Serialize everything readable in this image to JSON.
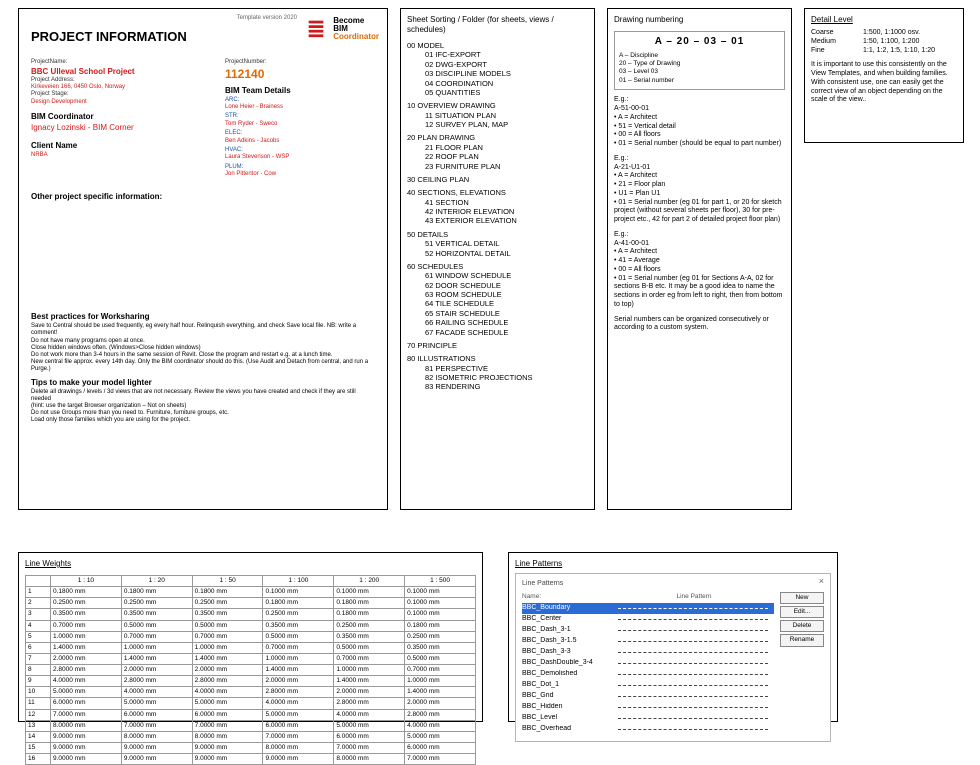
{
  "projectInfo": {
    "templateVersion": "Template version 2020",
    "heading": "PROJECT INFORMATION",
    "logo": {
      "line1": "Become",
      "line2": "BIM",
      "line3": "Coordinator"
    },
    "fields": {
      "projectName_lbl": "ProjectName:",
      "projectName": "BBC Ulleval School Project",
      "projectAddress_lbl": "Project Address:",
      "projectAddress": "Kirkeveien 166, 0450 Oslo, Norway",
      "projectStage_lbl": "Project Stage:",
      "projectStage": "Design Development",
      "projectNumber_lbl": "ProjectNumber:",
      "projectNumber": "112140",
      "bimCoord_h": "BIM Coordinator",
      "bimCoord": "Ignacy Lozinski - BIM Corner",
      "client_h": "Client Name",
      "client": "NRBA",
      "team_h": "BIM Team Details",
      "arc_l": "ARC:",
      "arc": "Lone Heier - Brainess",
      "str_l": "STR:",
      "str": "Tom Ryder - Sweco",
      "elec_l": "ELEC:",
      "elec": "Ben Adkins - Jacobs",
      "hvac_l": "HVAC:",
      "hvac": "Laura Stevenson - WSP",
      "plum_l": "PLUM:",
      "plum": "Jon Pittentor - Cow"
    },
    "otherInfo_h": "Other project specific information:",
    "ws_h": "Best practices for Worksharing",
    "ws_lines": [
      "Save to Central should be used frequently, eg every half hour. Relinquish everything, and check Save local file. NB: write a comment!",
      "Do not have many programs open at once.",
      "Close hidden windows often. (Windows>Close hidden windows)",
      "Do not work more than 3-4 hours in the same session of Revit. Close the program and restart e.g. at a lunch time.",
      "New central file approx. every 14th day. Only the BIM coordinator should do this. (Use Audit and Detach from central, and run a Purge.)"
    ],
    "tips_h": "Tips to make your model lighter",
    "tips_lines": [
      "Delete all drawings / levels / 3d views that are not necessary. Review the views you have created and check if they are still needed",
      "(hint: use the target Browser organization – Not on sheets)",
      "Do not use Groups more than you need to. Furniture, furniture groups, etc.",
      "Load only those families which you are using for the project."
    ]
  },
  "sheetSorting": {
    "heading": "Sheet Sorting / Folder (for sheets, views / schedules)",
    "groups": [
      {
        "h": "00 MODEL",
        "items": [
          "01 IFC-EXPORT",
          "02 DWG-EXPORT",
          "03 DISCIPLINE MODELS",
          "04 COORDINATION",
          "05 QUANTITIES"
        ]
      },
      {
        "h": "10 OVERVIEW DRAWING",
        "items": [
          "11 SITUATION PLAN",
          "12 SURVEY PLAN, MAP"
        ]
      },
      {
        "h": "20 PLAN DRAWING",
        "items": [
          "21 FLOOR PLAN",
          "22 ROOF PLAN",
          "23 FURNITURE PLAN"
        ]
      },
      {
        "h": "30 CEILING PLAN",
        "items": []
      },
      {
        "h": "40 SECTIONS, ELEVATIONS",
        "items": [
          "41 SECTION",
          "42 INTERIOR ELEVATION",
          "43 EXTERIOR ELEVATION"
        ]
      },
      {
        "h": "50 DETAILS",
        "items": [
          "51 VERTICAL DETAIL",
          "52 HORIZONTAL DETAIL"
        ]
      },
      {
        "h": "60 SCHEDULES",
        "items": [
          "61 WINDOW SCHEDULE",
          "62 DOOR SCHEDULE",
          "63 ROOM SCHEDULE",
          "64 TILE SCHEDULE",
          "65 STAIR SCHEDULE",
          "66 RAILING SCHEDULE",
          "67 FACADE SCHEDULE"
        ]
      },
      {
        "h": "70 PRINCIPLE",
        "items": []
      },
      {
        "h": "80 ILLUSTRATIONS",
        "items": [
          "81 PERSPECTIVE",
          "82 ISOMETRIC PROJECTIONS",
          "83 RENDERING"
        ]
      }
    ]
  },
  "drawingNumbering": {
    "heading": "Drawing numbering",
    "pattern": "A – 20 – 03 – 01",
    "legend": [
      "A – Discipline",
      "20 – Type of Drawing",
      "03 – Level 03",
      "01 – Serial number"
    ],
    "ex1_h": "E.g.:",
    "ex1_code": "A-51-00-01",
    "ex1_lines": [
      "• A = Architect",
      "• 51 = Vertical detail",
      "• 00 = All floors",
      "• 01 = Serial number (should be equal to part number)"
    ],
    "ex2_h": "E.g.:",
    "ex2_code": "A-21-U1-01",
    "ex2_lines": [
      "• A = Architect",
      "• 21 = Floor plan",
      "• U1 = Plan U1",
      "• 01 = Serial number (eg 01 for part 1, or 20 for sketch project (without several sheets per floor), 30 for pre-project etc., 42 for part 2 of detailed project floor plan)"
    ],
    "ex3_h": "E.g.:",
    "ex3_code": "A-41-00-01",
    "ex3_lines": [
      "• A = Architect",
      "• 41 = Average",
      "• 00 = All floors",
      "• 01 = Serial number (eg 01 for Sections A-A, 02 for sections B-B etc. It may be a good idea to name the sections in order eg from left to right, then from bottom to top)"
    ],
    "note": "Serial numbers can be organized consecutively or according to a custom system."
  },
  "detailLevel": {
    "heading": "Detail Level",
    "rows": [
      {
        "k": "Coarse",
        "v": "1:500, 1:1000 osv."
      },
      {
        "k": "Medium",
        "v": "1:50, 1:100, 1:200"
      },
      {
        "k": "Fine",
        "v": "1:1, 1:2, 1:5, 1:10, 1:20"
      }
    ],
    "note": "It is important to use this consistently on the View Templates, and when building families. With consistent use, one can easily get the correct view of an object depending on the scale of the view.."
  },
  "lineWeights": {
    "heading": "Line Weights",
    "cols": [
      "",
      "1 : 10",
      "1 : 20",
      "1 : 50",
      "1 : 100",
      "1 : 200",
      "1 : 500"
    ],
    "rows": [
      [
        "1",
        "0.1800 mm",
        "0.1800 mm",
        "0.1800 mm",
        "0.1000 mm",
        "0.1000 mm",
        "0.1000 mm"
      ],
      [
        "2",
        "0.2500 mm",
        "0.2500 mm",
        "0.2500 mm",
        "0.1800 mm",
        "0.1800 mm",
        "0.1000 mm"
      ],
      [
        "3",
        "0.3500 mm",
        "0.3500 mm",
        "0.3500 mm",
        "0.2500 mm",
        "0.1800 mm",
        "0.1000 mm"
      ],
      [
        "4",
        "0.7000 mm",
        "0.5000 mm",
        "0.5000 mm",
        "0.3500 mm",
        "0.2500 mm",
        "0.1800 mm"
      ],
      [
        "5",
        "1.0000 mm",
        "0.7000 mm",
        "0.7000 mm",
        "0.5000 mm",
        "0.3500 mm",
        "0.2500 mm"
      ],
      [
        "6",
        "1.4000 mm",
        "1.0000 mm",
        "1.0000 mm",
        "0.7000 mm",
        "0.5000 mm",
        "0.3500 mm"
      ],
      [
        "7",
        "2.0000 mm",
        "1.4000 mm",
        "1.4000 mm",
        "1.0000 mm",
        "0.7000 mm",
        "0.5000 mm"
      ],
      [
        "8",
        "2.8000 mm",
        "2.0000 mm",
        "2.0000 mm",
        "1.4000 mm",
        "1.0000 mm",
        "0.7000 mm"
      ],
      [
        "9",
        "4.0000 mm",
        "2.8000 mm",
        "2.8000 mm",
        "2.0000 mm",
        "1.4000 mm",
        "1.0000 mm"
      ],
      [
        "10",
        "5.0000 mm",
        "4.0000 mm",
        "4.0000 mm",
        "2.8000 mm",
        "2.0000 mm",
        "1.4000 mm"
      ],
      [
        "11",
        "6.0000 mm",
        "5.0000 mm",
        "5.0000 mm",
        "4.0000 mm",
        "2.8000 mm",
        "2.0000 mm"
      ],
      [
        "12",
        "7.0000 mm",
        "6.0000 mm",
        "6.0000 mm",
        "5.0000 mm",
        "4.0000 mm",
        "2.8000 mm"
      ],
      [
        "13",
        "8.0000 mm",
        "7.0000 mm",
        "7.0000 mm",
        "6.0000 mm",
        "5.0000 mm",
        "4.0000 mm"
      ],
      [
        "14",
        "9.0000 mm",
        "8.0000 mm",
        "8.0000 mm",
        "7.0000 mm",
        "6.0000 mm",
        "5.0000 mm"
      ],
      [
        "15",
        "9.0000 mm",
        "9.0000 mm",
        "9.0000 mm",
        "8.0000 mm",
        "7.0000 mm",
        "6.0000 mm"
      ],
      [
        "16",
        "9.0000 mm",
        "9.0000 mm",
        "9.0000 mm",
        "9.0000 mm",
        "8.0000 mm",
        "7.0000 mm"
      ]
    ]
  },
  "linePatterns": {
    "heading": "Line Patterns",
    "dlgTitle": "Line Patterns",
    "colName": "Name:",
    "colPattern": "Line Pattern",
    "rows": [
      "BBC_Boundary",
      "BBC_Center",
      "BBC_Dash_3-1",
      "BBC_Dash_3-1.5",
      "BBC_Dash_3-3",
      "BBC_DashDouble_3-4",
      "BBC_Demolished",
      "BBC_Dot_1",
      "BBC_Grid",
      "BBC_Hidden",
      "BBC_Level",
      "BBC_Overhead"
    ],
    "selected": 0,
    "buttons": [
      "New",
      "Edit...",
      "Delete",
      "Rename"
    ],
    "closeX": "×"
  }
}
